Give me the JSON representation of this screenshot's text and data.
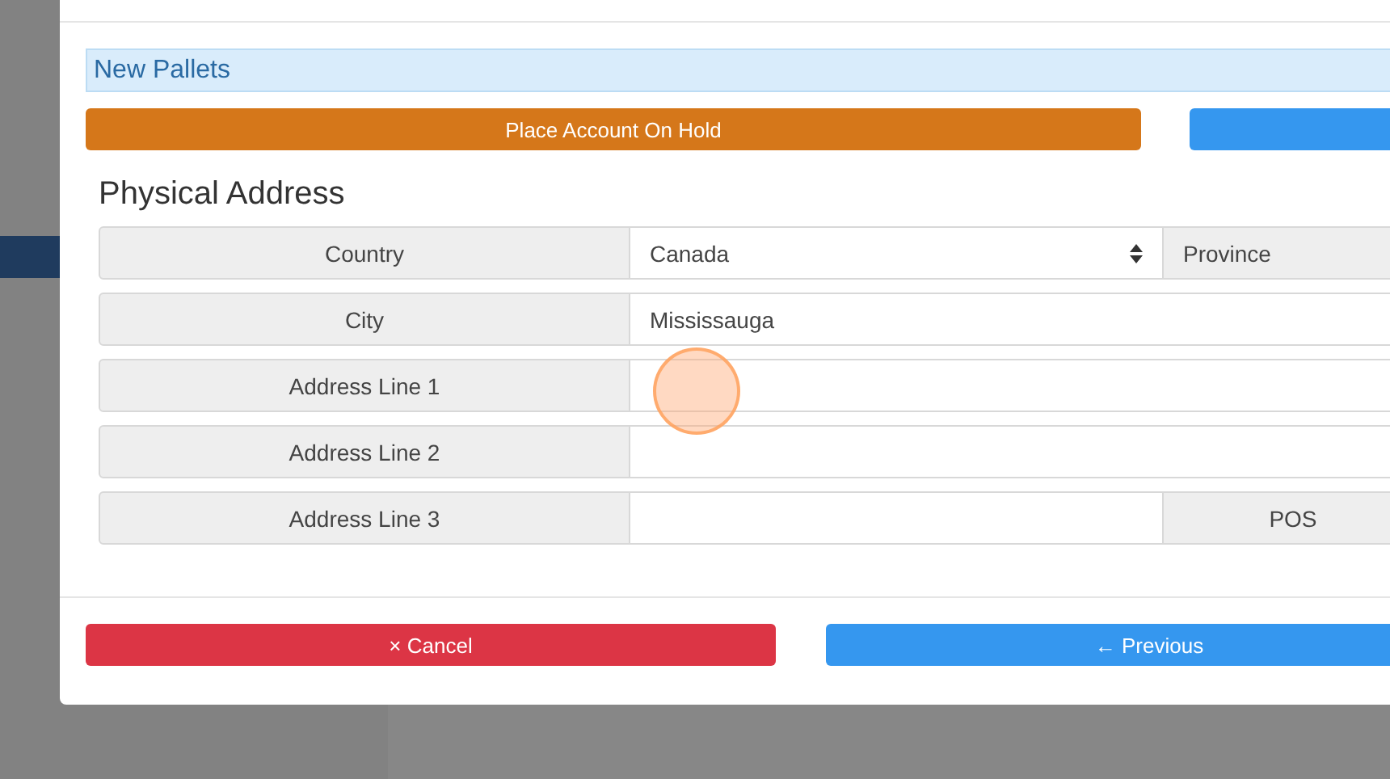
{
  "banner": "New Pallets",
  "actions": [
    {
      "label": "Place Account On Hold",
      "kind": "warning"
    },
    {
      "kind": "primary"
    }
  ],
  "section_title": "Physical Address",
  "rows": [
    {
      "label": "Country",
      "field": {
        "kind": "select",
        "value": "Canada"
      },
      "extra": {
        "kind": "field-label",
        "text": "Province"
      }
    },
    {
      "label": "City",
      "field": {
        "kind": "text",
        "value": "Mississauga"
      }
    },
    {
      "label": "Address Line 1",
      "field": {
        "kind": "text"
      }
    },
    {
      "label": "Address Line 2",
      "field": {
        "kind": "text"
      }
    },
    {
      "label": "Address Line 3",
      "field": {
        "kind": "text"
      },
      "extra": {
        "kind": "label",
        "text": "POS"
      }
    }
  ],
  "footer": [
    {
      "label": "× Cancel",
      "kind": "danger"
    },
    {
      "label": "← Previous",
      "kind": "primary"
    }
  ]
}
